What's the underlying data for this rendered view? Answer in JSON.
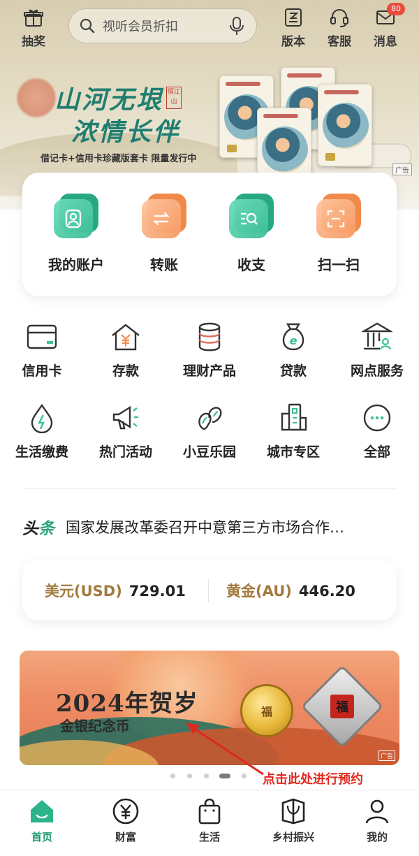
{
  "topbar": {
    "lottery": "抽奖",
    "search_placeholder": "视听会员折扣",
    "version": "版本",
    "service": "客服",
    "messages": "消息",
    "messages_badge": "80"
  },
  "hero": {
    "title_line1": "山河无垠",
    "title_line2": "浓情长伴",
    "seal": "恒江山",
    "subtitle": "借记卡+信用卡珍藏版套卡 限量发行中",
    "ad_tag": "广告"
  },
  "quick": [
    {
      "label": "我的账户",
      "icon": "account-icon",
      "color": "green"
    },
    {
      "label": "转账",
      "icon": "transfer-icon",
      "color": "orange"
    },
    {
      "label": "收支",
      "icon": "income-expense-icon",
      "color": "green"
    },
    {
      "label": "扫一扫",
      "icon": "scan-icon",
      "color": "orange"
    }
  ],
  "grid": [
    {
      "label": "信用卡",
      "icon": "credit-card-icon"
    },
    {
      "label": "存款",
      "icon": "deposit-icon"
    },
    {
      "label": "理财产品",
      "icon": "wealth-products-icon"
    },
    {
      "label": "贷款",
      "icon": "loan-icon"
    },
    {
      "label": "网点服务",
      "icon": "branch-service-icon"
    },
    {
      "label": "生活缴费",
      "icon": "bill-payment-icon"
    },
    {
      "label": "热门活动",
      "icon": "hot-events-icon"
    },
    {
      "label": "小豆乐园",
      "icon": "bean-park-icon"
    },
    {
      "label": "城市专区",
      "icon": "city-zone-icon"
    },
    {
      "label": "全部",
      "icon": "more-icon"
    }
  ],
  "news": {
    "tag_part1": "头",
    "tag_part2": "条",
    "text": "国家发展改革委召开中意第三方市场合作…"
  },
  "rates": {
    "usd_label": "美元(USD)",
    "usd_value": "729.01",
    "gold_label": "黄金(AU)",
    "gold_value": "446.20"
  },
  "promo": {
    "title": "2024年贺岁",
    "subtitle": "金银纪念币",
    "coin_char": "福",
    "ad_tag": "广告"
  },
  "annotation": "点击此处进行预约",
  "bottom_nav": [
    {
      "label": "首页",
      "icon": "home-icon",
      "active": true
    },
    {
      "label": "财富",
      "icon": "wealth-icon",
      "active": false
    },
    {
      "label": "生活",
      "icon": "life-icon",
      "active": false
    },
    {
      "label": "乡村振兴",
      "icon": "rural-icon",
      "active": false
    },
    {
      "label": "我的",
      "icon": "profile-icon",
      "active": false
    }
  ],
  "colors": {
    "brand_green": "#1f9a72",
    "accent_orange": "#f08a4b",
    "gold_text": "#a27a3e",
    "annotation_red": "#e0281f"
  }
}
